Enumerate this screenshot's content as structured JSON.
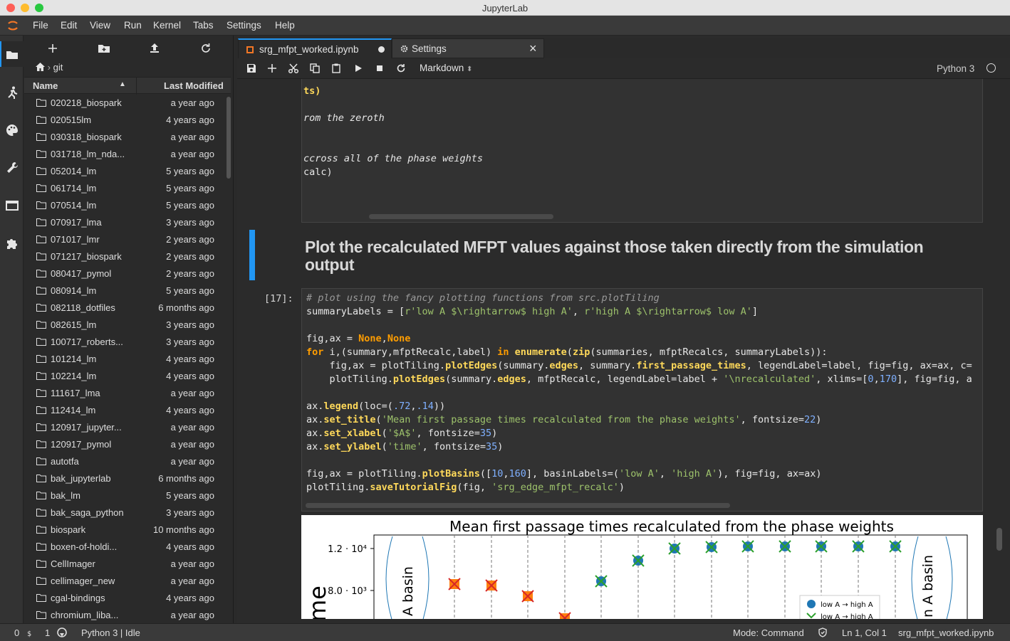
{
  "window": {
    "title": "JupyterLab"
  },
  "menu": [
    "File",
    "Edit",
    "View",
    "Run",
    "Kernel",
    "Tabs",
    "Settings",
    "Help"
  ],
  "breadcrumb": "git",
  "filebrowser": {
    "col_name": "Name",
    "col_modified": "Last Modified",
    "files": [
      {
        "name": "020218_biospark",
        "modified": "a year ago"
      },
      {
        "name": "020515lm",
        "modified": "4 years ago"
      },
      {
        "name": "030318_biospark",
        "modified": "a year ago"
      },
      {
        "name": "031718_lm_nda...",
        "modified": "a year ago"
      },
      {
        "name": "052014_lm",
        "modified": "5 years ago"
      },
      {
        "name": "061714_lm",
        "modified": "5 years ago"
      },
      {
        "name": "070514_lm",
        "modified": "5 years ago"
      },
      {
        "name": "070917_lma",
        "modified": "3 years ago"
      },
      {
        "name": "071017_lmr",
        "modified": "2 years ago"
      },
      {
        "name": "071217_biospark",
        "modified": "2 years ago"
      },
      {
        "name": "080417_pymol",
        "modified": "2 years ago"
      },
      {
        "name": "080914_lm",
        "modified": "5 years ago"
      },
      {
        "name": "082118_dotfiles",
        "modified": "6 months ago"
      },
      {
        "name": "082615_lm",
        "modified": "3 years ago"
      },
      {
        "name": "100717_roberts...",
        "modified": "3 years ago"
      },
      {
        "name": "101214_lm",
        "modified": "4 years ago"
      },
      {
        "name": "102214_lm",
        "modified": "4 years ago"
      },
      {
        "name": "111617_lma",
        "modified": "a year ago"
      },
      {
        "name": "112414_lm",
        "modified": "4 years ago"
      },
      {
        "name": "120917_jupyter...",
        "modified": "a year ago"
      },
      {
        "name": "120917_pymol",
        "modified": "a year ago"
      },
      {
        "name": "autotfa",
        "modified": "a year ago"
      },
      {
        "name": "bak_jupyterlab",
        "modified": "6 months ago"
      },
      {
        "name": "bak_lm",
        "modified": "5 years ago"
      },
      {
        "name": "bak_saga_python",
        "modified": "3 years ago"
      },
      {
        "name": "biospark",
        "modified": "10 months ago"
      },
      {
        "name": "boxen-of-holdi...",
        "modified": "4 years ago"
      },
      {
        "name": "CellImager",
        "modified": "a year ago"
      },
      {
        "name": "cellimager_new",
        "modified": "a year ago"
      },
      {
        "name": "cgal-bindings",
        "modified": "4 years ago"
      },
      {
        "name": "chromium_liba...",
        "modified": "a year ago"
      }
    ]
  },
  "tabs": [
    {
      "label": "srg_mfpt_worked.ipynb"
    },
    {
      "label": "Settings"
    }
  ],
  "notebook": {
    "cell_type": "Markdown",
    "kernel": "Python 3",
    "cell1_lines": [
      "ts)",
      "",
      "rom the zeroth",
      "",
      "",
      "ccross all of the phase weights",
      "calc)"
    ],
    "heading": "Plot the recalculated MFPT values against those taken directly from the simulation output",
    "prompt": "[17]:",
    "code": {
      "l1": "# plot using the fancy plotting functions from src.plotTiling",
      "l2a": "summaryLabels = [",
      "l2b": "r'low A $\\rightarrow$ high A'",
      "l2c": ", ",
      "l2d": "r'high A $\\rightarrow$ low A'",
      "l2e": "]",
      "l4a": "fig,ax = ",
      "l4b": "None",
      "l4c": ",",
      "l4d": "None",
      "l5a": "for",
      " l5b": " i,(summary,mfptRecalc,label) ",
      "l5c": "in",
      " l5d": " ",
      "l5e": "enumerate",
      "l5f": "(",
      "l5g": "zip",
      "l5h": "(summaries, mfptRecalcs, summaryLabels)):",
      "l6a": "    fig,ax = plotTiling.",
      "l6b": "plotEdges",
      "l6c": "(summary.",
      "l6d": "edges",
      "l6e": ", summary.",
      "l6f": "first_passage_times",
      "l6g": ", legendLabel=label, fig=fig, ax=ax, c=",
      "l7a": "    plotTiling.",
      "l7b": "plotEdges",
      "l7c": "(summary.",
      "l7d": "edges",
      "l7e": ", mfptRecalc, legendLabel=label + ",
      "l7f": "'\\nrecalculated'",
      "l7g": ", xlims=[",
      "l7h": "0",
      "l7i": ",",
      "l7j": "170",
      "l7k": "], fig=fig, a",
      "l9a": "ax.",
      "l9b": "legend",
      "l9c": "(loc=(",
      ".l9d": "",
      "l9e": ".72",
      ",l9f": "",
      "l9g": ",",
      ".l9h": "",
      "l9i": ".14",
      "l9j": "))",
      "l10a": "ax.",
      "l10b": "set_title",
      "l10c": "(",
      "l10d": "'Mean first passage times recalculated from the phase weights'",
      "l10e": ", fontsize=",
      "l10f": "22",
      "l10g": ")",
      "l11a": "ax.",
      "l11b": "set_xlabel",
      "l11c": "(",
      "l11d": "'$A$'",
      "l11e": ", fontsize=",
      "l11f": "35",
      "l11g": ")",
      "l12a": "ax.",
      "l12b": "set_ylabel",
      "l12c": "(",
      "l12d": "'time'",
      "l12e": ", fontsize=",
      "l12f": "35",
      "l12g": ")",
      "l14a": "fig,ax = plotTiling.",
      "l14b": "plotBasins",
      "l14c": "([",
      "l14d": "10",
      "l14e": ",",
      "l14f": "160",
      "l14g": "], basinLabels=(",
      "l14h": "'low A'",
      "l14i": ", ",
      "l14j": "'high A'",
      "l14k": "), fig=fig, ax=ax)",
      "l15a": "plotTiling.",
      "l15b": "saveTutorialFig",
      "l15c": "(fig, ",
      "l15d": "'srg_edge_mfpt_recalc'",
      "l15e": ")"
    }
  },
  "output_plot": {
    "title": "Mean first passage times recalculated from the phase weights",
    "ytick1": "1.2 · 10⁴",
    "ytick2": "8.0 · 10³",
    "ylabel": "me",
    "basin_left": "A basin",
    "basin_right": "n A basin",
    "legend1": "low A → high A",
    "legend2": "low A → high A"
  },
  "status": {
    "zero": "0",
    "one": "1",
    "kernel": "Python 3 | Idle",
    "mode": "Mode: Command",
    "pos": "Ln 1, Col 1",
    "file": "srg_mfpt_worked.ipynb"
  },
  "colors": {
    "accent": "#2196f3",
    "marker_blue": "#1f77b4",
    "marker_green": "#2ca02c",
    "marker_orange": "#ff7f0e",
    "marker_red": "#d62728"
  }
}
